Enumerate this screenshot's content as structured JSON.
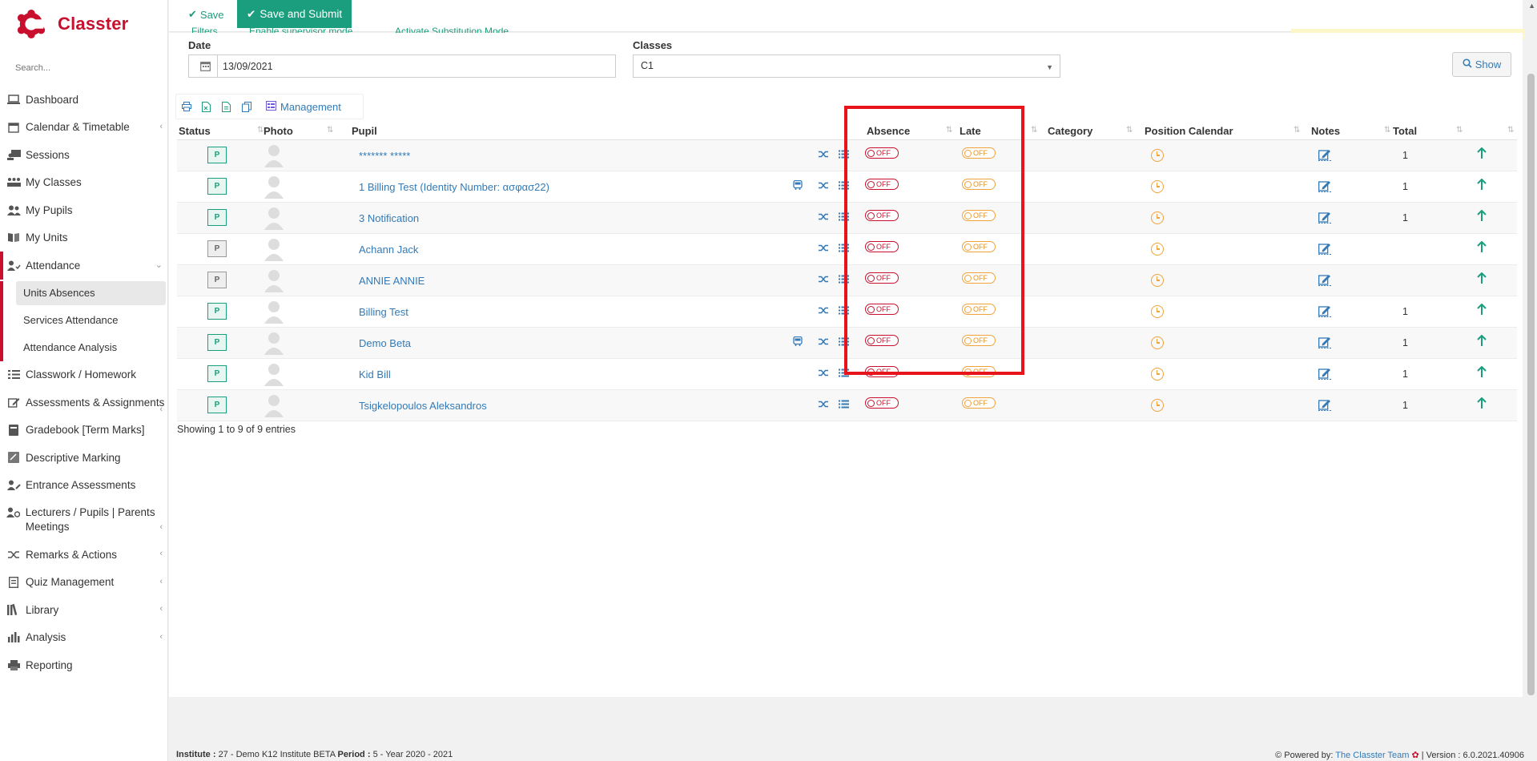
{
  "app": {
    "name": "Classter"
  },
  "search": {
    "placeholder": "Search..."
  },
  "nav": {
    "dashboard": "Dashboard",
    "calendar": "Calendar & Timetable",
    "sessions": "Sessions",
    "my_classes": "My Classes",
    "my_pupils": "My Pupils",
    "my_units": "My Units",
    "attendance": "Attendance",
    "units_absences": "Units Absences",
    "services_attendance": "Services Attendance",
    "attendance_analysis": "Attendance Analysis",
    "classwork": "Classwork / Homework",
    "assessments": "Assessments & Assignments",
    "gradebook": "Gradebook [Term Marks]",
    "descriptive": "Descriptive Marking",
    "entrance": "Entrance Assessments",
    "meetings": "Lecturers / Pupils | Parents Meetings",
    "remarks": "Remarks & Actions",
    "quiz": "Quiz Management",
    "library": "Library",
    "analysis": "Analysis",
    "reporting": "Reporting"
  },
  "toolbar": {
    "save": "Save",
    "save_submit": "Save and Submit",
    "management": "Management"
  },
  "peek": {
    "filters": "Filters",
    "supervisor": "Enable supervisor mode",
    "substitution": "Activate Substitution Mode"
  },
  "filters": {
    "date_label": "Date",
    "date_value": "13/09/2021",
    "classes_label": "Classes",
    "classes_value": "C1",
    "show": "Show"
  },
  "table": {
    "headers": {
      "status": "Status",
      "photo": "Photo",
      "pupil": "Pupil",
      "absence": "Absence",
      "late": "Late",
      "category": "Category",
      "position": "Position Calendar",
      "notes": "Notes",
      "total": "Total"
    },
    "toggle_off": "OFF",
    "rows": [
      {
        "status": "P",
        "name": "******* *****",
        "total": "1"
      },
      {
        "status": "P",
        "name": "1 Billing Test (Identity Number: ασφασ22)",
        "total": "1"
      },
      {
        "status": "P",
        "name": "3 Notification",
        "total": "1"
      },
      {
        "status": "P",
        "name": "Achann Jack",
        "total": ""
      },
      {
        "status": "P",
        "name": "ANNIE ANNIE",
        "total": ""
      },
      {
        "status": "P",
        "name": "Billing Test",
        "total": "1"
      },
      {
        "status": "P",
        "name": "Demo Beta",
        "total": "1"
      },
      {
        "status": "P",
        "name": "Kid Bill",
        "total": "1"
      },
      {
        "status": "P",
        "name": "Tsigkelopoulos Aleksandros",
        "total": "1"
      }
    ],
    "entries": "Showing 1 to 9 of 9 entries"
  },
  "footer": {
    "institute_label": "Institute :",
    "institute_value": "27 - Demo K12 Institute BETA",
    "period_label": "Period :",
    "period_value": "5 - Year 2020 - 2021",
    "powered_by": "Powered by:",
    "team": "The Classter Team",
    "version": "| Version : 6.0.2021.40906"
  },
  "colors": {
    "brand": "#c8102e",
    "accent": "#1a9e7d",
    "link": "#337ab7",
    "highlight": "#e8141c",
    "late": "#f0a23c"
  },
  "icons": {
    "date": "calendar-icon",
    "show": "search-icon",
    "print": "print-icon",
    "excel": "excel-icon",
    "copy": "copy-icon",
    "shuffle": "shuffle-icon",
    "list": "list-icon",
    "bus": "bus-icon",
    "clock": "clock-icon",
    "note": "edit-note-icon",
    "arrow": "arrow-up-icon"
  }
}
